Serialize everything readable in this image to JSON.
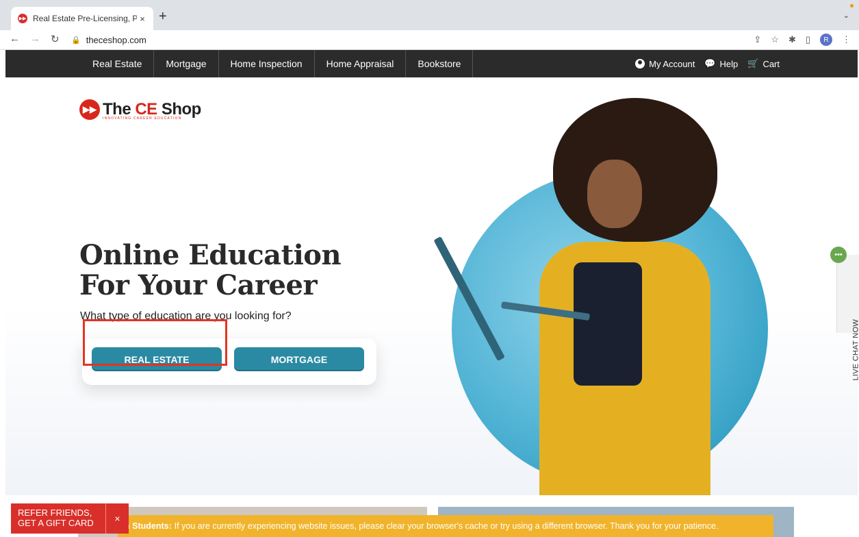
{
  "browser": {
    "tab_title": "Real Estate Pre-Licensing, Pos",
    "tab_close": "×",
    "new_tab": "+",
    "url": "theceshop.com",
    "profile_initial": "R",
    "icons": [
      "back-icon",
      "forward-icon",
      "reload-icon",
      "lock-icon",
      "share-icon",
      "bookmark-star-icon",
      "extensions-icon",
      "sidepanel-icon",
      "menu-icon"
    ]
  },
  "sitenav": {
    "items": [
      "Real Estate",
      "Mortgage",
      "Home Inspection",
      "Home Appraisal",
      "Bookstore"
    ],
    "account": "My Account",
    "help": "Help",
    "cart": "Cart"
  },
  "hero": {
    "logo_the": "The ",
    "logo_ce": "CE",
    "logo_shop": " Shop",
    "logo_tagline": "INNOVATING CAREER EDUCATION",
    "headline_line1": "Online Education",
    "headline_line2": "For Your Career",
    "subtitle": "What type of education are you looking for?",
    "btn_real_estate": "REAL ESTATE",
    "btn_mortgage": "MORTGAGE"
  },
  "live_chat": {
    "label": "LIVE CHAT NOW"
  },
  "footer": {
    "refer_line1": "REFER FRIENDS,",
    "refer_line2": "GET A GIFT CARD",
    "refer_close": "×",
    "notice_bold": "n Students:",
    "notice_text": "If you are currently experiencing website issues, please clear your browser's cache or try using a different browser. Thank you for your patience."
  },
  "colors": {
    "nav_bg": "#2b2b2b",
    "brand_red": "#d9261c",
    "button_teal": "#2a8aa3",
    "notice_yellow": "#f1b32b",
    "highlight_red": "#e53322"
  }
}
